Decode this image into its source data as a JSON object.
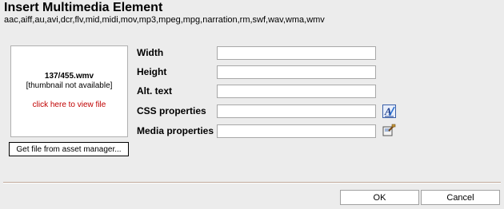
{
  "dialog": {
    "title": "Insert Multimedia Element",
    "formats": "aac,aiff,au,avi,dcr,flv,mid,midi,mov,mp3,mpeg,mpg,narration,rm,swf,wav,wma,wmv"
  },
  "preview": {
    "filename": "137/455.wmv",
    "thumbnail_note": "[thumbnail not available]",
    "view_link": "click here to view file",
    "asset_button": "Get file from asset manager..."
  },
  "fields": {
    "width_label": "Width",
    "width_value": "",
    "height_label": "Height",
    "height_value": "",
    "alt_label": "Alt. text",
    "alt_value": "",
    "css_label": "CSS properties",
    "css_value": "",
    "media_label": "Media properties",
    "media_value": ""
  },
  "icons": {
    "css": "css-style-icon",
    "media": "media-properties-icon"
  },
  "buttons": {
    "ok": "OK",
    "cancel": "Cancel"
  }
}
